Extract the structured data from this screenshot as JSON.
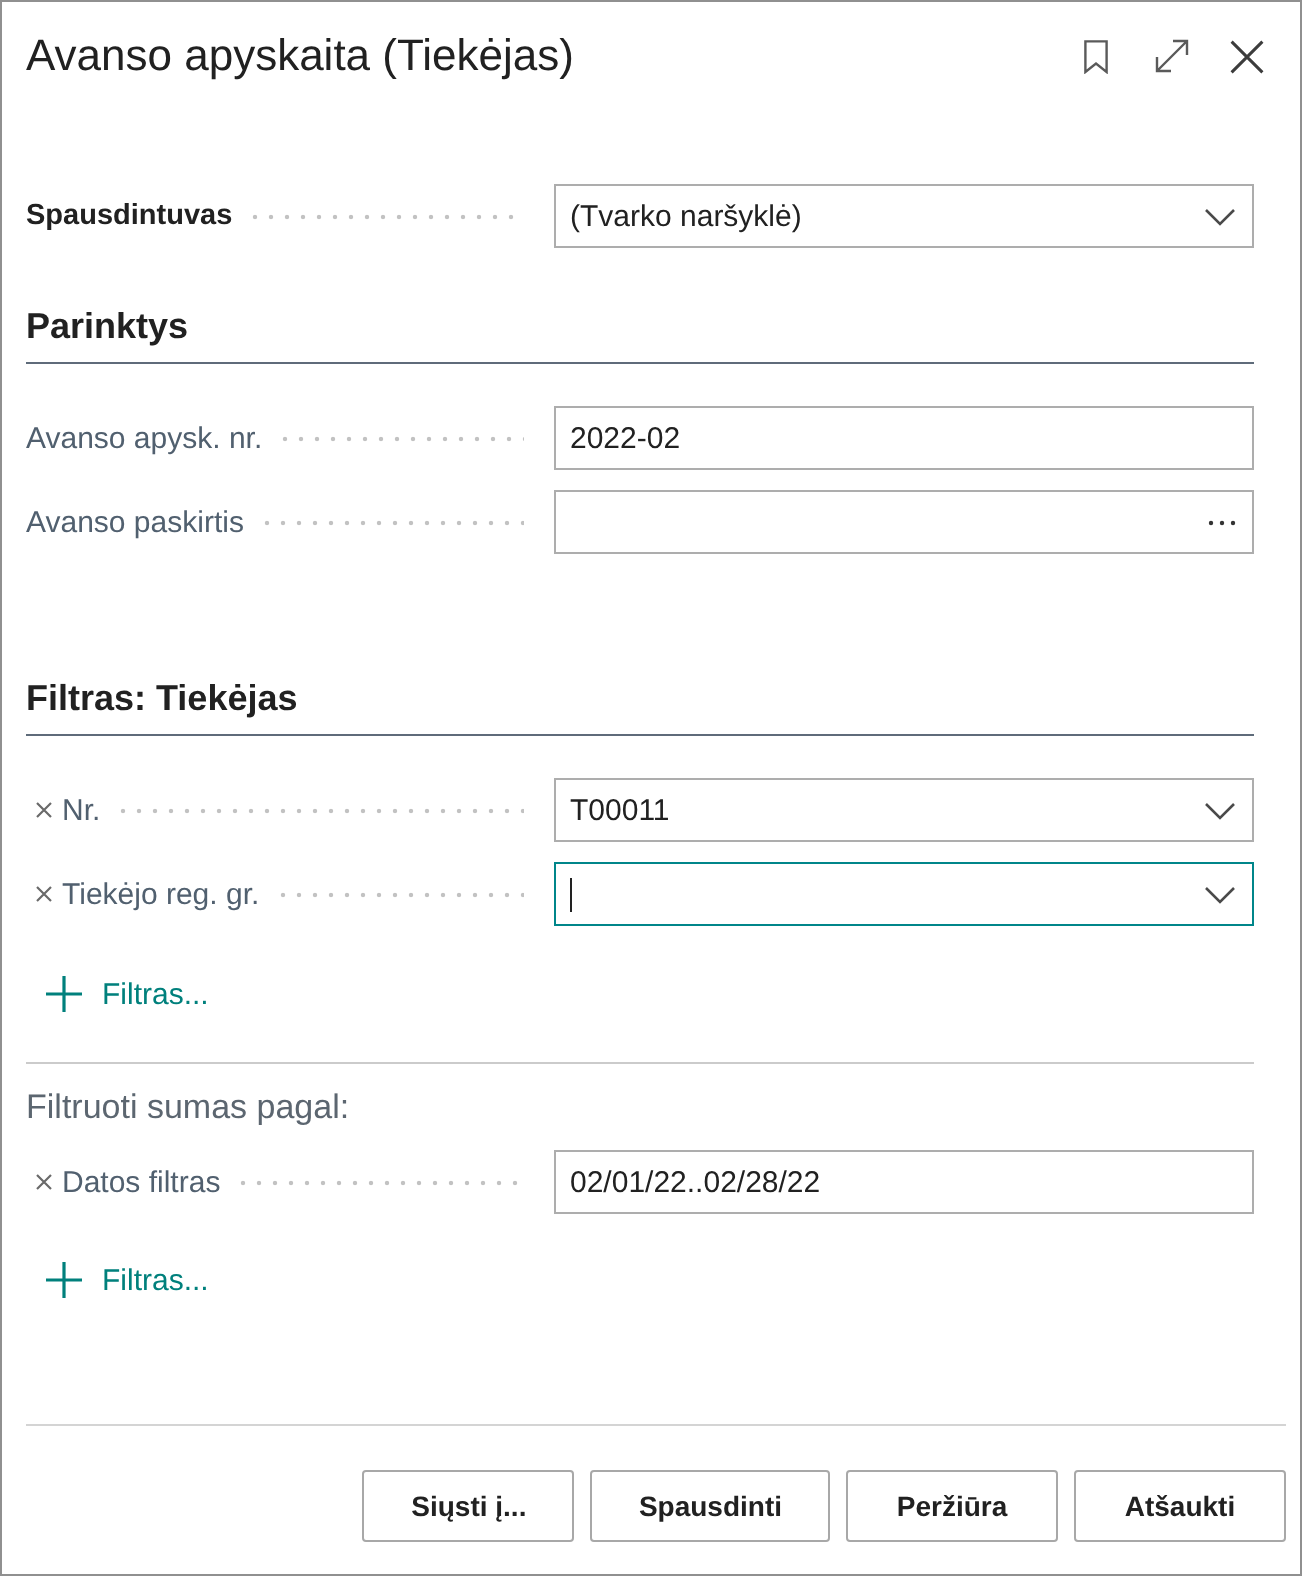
{
  "window": {
    "title": "Avanso apyskaita (Tiekėjas)"
  },
  "sections": [
    {
      "kind": "plain",
      "fields": [
        {
          "label": "Spausdintuvas",
          "value": "(Tvarko naršyklė)",
          "kind": "dropdown",
          "focused": false
        }
      ]
    },
    {
      "kind": "group",
      "heading": "Parinktys",
      "fields": [
        {
          "label": "Avanso apysk. nr.",
          "value": "2022-02",
          "kind": "text",
          "focused": false
        },
        {
          "label": "Avanso paskirtis",
          "kind": "lookup",
          "focused": false
        }
      ]
    },
    {
      "kind": "group",
      "heading": "Filtras: Tiekėjas",
      "fields": [
        {
          "label": "Nr.",
          "value": "T00011",
          "kind": "dropdown",
          "removable": true,
          "focused": false
        },
        {
          "label": "Tiekėjo reg. gr.",
          "kind": "dropdown",
          "removable": true,
          "focused": true
        }
      ],
      "add_filter": "Filtras..."
    },
    {
      "kind": "subgroup",
      "heading": "Filtruoti sumas pagal:",
      "fields": [
        {
          "label": "Datos filtras",
          "value": "02/01/22..02/28/22",
          "kind": "text",
          "removable": true,
          "focused": false
        }
      ],
      "add_filter": "Filtras..."
    }
  ],
  "buttons": [
    {
      "label": "Siųsti į..."
    },
    {
      "label": "Spausdinti"
    },
    {
      "label": "Peržiūra"
    },
    {
      "label": "Atšaukti"
    }
  ]
}
